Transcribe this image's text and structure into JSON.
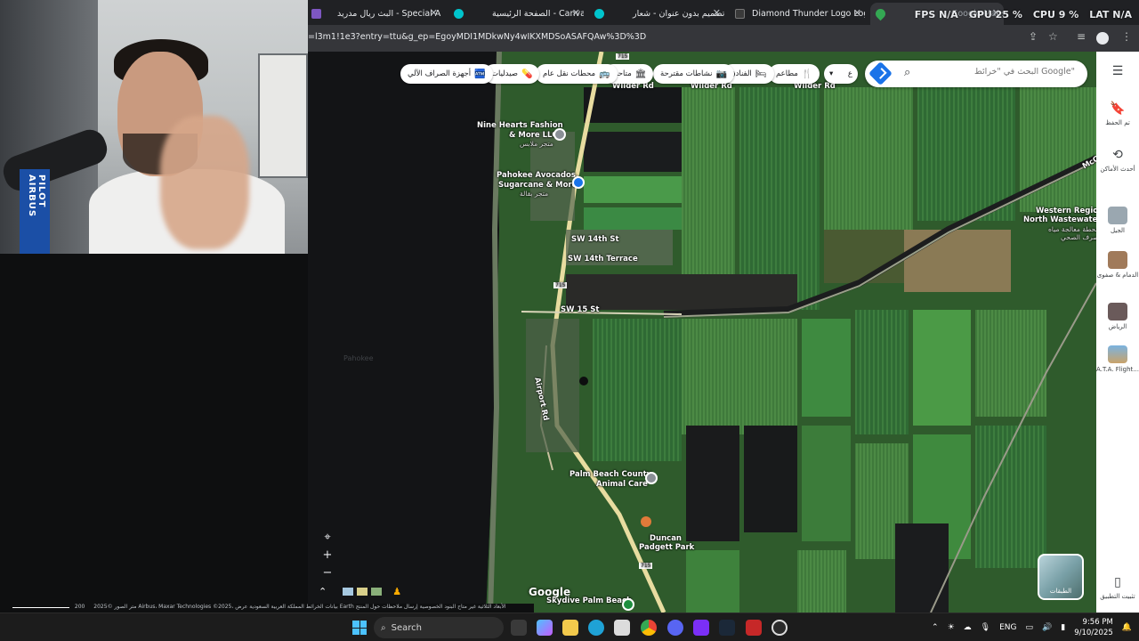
{
  "browser": {
    "tabs": [
      {
        "title": "البث ريال مدريد - Special Alert",
        "color": "#7e57c2"
      },
      {
        "title": "الصفحة الرئيسية - Canva",
        "color": "#00c4cc"
      },
      {
        "title": "تصميم بدون عنوان - شعار",
        "color": "#00c4cc"
      },
      {
        "title": "Diamond Thunder Logo Logo",
        "color": "#3a3a3a"
      },
      {
        "title": "Google Maps",
        "color": "#34a853"
      }
    ],
    "url": "=l3m1!1e3?entry=ttu&g_ep=EgoyMDI1MDkwNy4wIKXMDSoASAFQAw%3D%3D"
  },
  "overlay_stats": {
    "fps": "FPS N/A",
    "gpu": "GPU 25 %",
    "cpu": "CPU  9 %",
    "lat": "LAT N/A"
  },
  "map": {
    "search_placeholder": "البحث في \"خرائط Google\"",
    "chips": [
      {
        "label": "مطاعم",
        "icon": "🍴"
      },
      {
        "label": "الفنادق",
        "icon": "🛏"
      },
      {
        "label": "نشاطات مقترحة",
        "icon": "📷"
      },
      {
        "label": "متاحف",
        "icon": "🏛"
      },
      {
        "label": "محطات نقل عام",
        "icon": "🚌"
      },
      {
        "label": "صيدليات",
        "icon": "💊"
      },
      {
        "label": "أجهزة الصراف الآلي",
        "icon": "🏧"
      }
    ],
    "places": [
      {
        "name": "Nine Hearts Fashion",
        "sub": "& More LLC"
      },
      {
        "name": "متجر ملابس",
        "sub": ""
      },
      {
        "name": "Pahokee Avocados,",
        "sub": "Sugarcane & More"
      },
      {
        "name": "متجر بقالة",
        "sub": ""
      },
      {
        "name": "Western Region",
        "sub": "North Wastewater"
      },
      {
        "name": "محطة معالجة مياه",
        "sub": "الصرف الصحي"
      },
      {
        "name": "Palm Beach County",
        "sub": "Animal Care"
      },
      {
        "name": "Duncan",
        "sub": "Padgett Park"
      },
      {
        "name": "Skydive Palm Beach",
        "sub": ""
      }
    ],
    "roads": [
      "Wilder Rd",
      "Wilder Rd",
      "Wilder Rd",
      "SW 14th St",
      "SW 14th Terrace",
      "SW 15 St",
      "Airport Rd",
      "715",
      "715",
      "715",
      "McC"
    ],
    "logo": "Google",
    "layers_label": "الطبقات",
    "scale": "200 متر",
    "footer": "الصور ©2025 Airbus، Maxar Technologies ©2025، بيانات الخرائط  المملكة العربية السعودية  عرض Earth  الأبعاد الثلاثية غير متاح  البنود  الخصوصية  إرسال ملاحظات حول المنتج"
  },
  "right_panel": [
    {
      "label": "تم الحفظ",
      "icon": "bookmark"
    },
    {
      "label": "أحدث الأماكن",
      "icon": "history"
    },
    {
      "label": "الجيل",
      "icon": "thumb"
    },
    {
      "label": "الدمام & صفوى",
      "icon": "thumb"
    },
    {
      "label": "الرياض",
      "icon": "thumb"
    },
    {
      "label": "A.T.A. Flight...",
      "icon": "thumb"
    },
    {
      "label": "تثبيت التطبيق",
      "icon": "phone"
    }
  ],
  "taskbar": {
    "search": "Search",
    "lang": "ENG",
    "time": "9:56 PM",
    "date": "9/10/2025"
  },
  "webcam": {
    "strap_text": "PILOT AIRBUS"
  }
}
